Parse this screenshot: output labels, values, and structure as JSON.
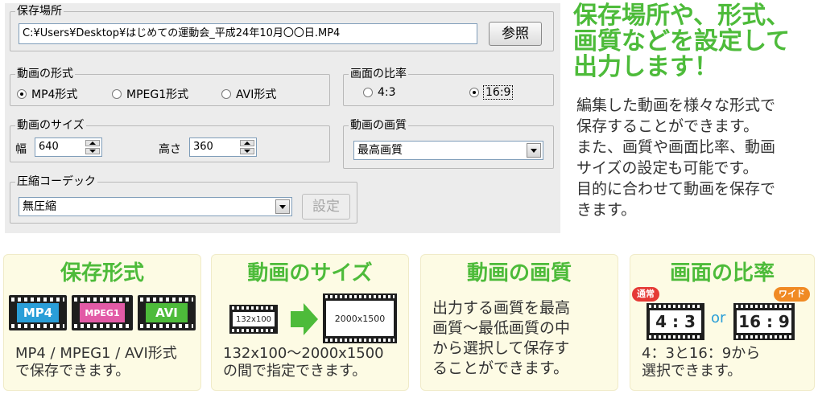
{
  "dialog": {
    "save_location": {
      "label": "保存場所",
      "path": "C:¥Users¥Desktop¥はじめての運動会_平成24年10月〇〇日.MP4",
      "browse_label": "参照"
    },
    "format": {
      "label": "動画の形式",
      "options": [
        "MP4形式",
        "MPEG1形式",
        "AVI形式"
      ],
      "selected": "MP4形式"
    },
    "aspect": {
      "label": "画面の比率",
      "options": [
        "4:3",
        "16:9"
      ],
      "selected": "16:9"
    },
    "size": {
      "label": "動画のサイズ",
      "width_label": "幅",
      "width_value": "640",
      "height_label": "高さ",
      "height_value": "360"
    },
    "quality": {
      "label": "動画の画質",
      "value": "最高画質"
    },
    "codec": {
      "label": "圧縮コーデック",
      "value": "無圧縮",
      "settings_label": "設定"
    }
  },
  "headline": {
    "lines": [
      "保存場所や、形式、",
      "画質などを設定して",
      "出力します！"
    ],
    "color": "#4dbb3a"
  },
  "description": {
    "lines": [
      "編集した動画を様々な形式で",
      "保存することができます。",
      "また、画質や画面比率、動画",
      "サイズの設定も可能です。",
      "目的に合わせて動画を保存で",
      "きます。"
    ]
  },
  "cards": {
    "format": {
      "title": "保存形式",
      "film_labels": [
        "MP4",
        "MPEG1",
        "AVI"
      ],
      "caption": [
        "MP4 / MPEG1 / AVI形式",
        "で保存できます。"
      ]
    },
    "size": {
      "title": "動画のサイズ",
      "small_label": "132x100",
      "large_label": "2000x1500",
      "caption": [
        "132x100〜2000x1500",
        "の間で指定できます。"
      ]
    },
    "quality": {
      "title": "動画の画質",
      "body": [
        "出力する画質を最高",
        "画質〜最低画質の中",
        "から選択して保存す",
        "ることができます。"
      ]
    },
    "ratio": {
      "title": "画面の比率",
      "normal_badge": "通常",
      "wide_badge": "ワイド",
      "ratio_43": "4 : 3",
      "ratio_169": "16 : 9",
      "or_text": "or",
      "caption": [
        "4：3と16：9から",
        "選択できます。"
      ]
    }
  },
  "colors": {
    "accent_green": "#4dbb3a",
    "card_bg": "#fdfbe4",
    "mp4_blue": "#2a9ed8",
    "mpeg1_pink": "#e25aa6",
    "avi_green": "#4dbb3a",
    "badge_red": "#e53935",
    "badge_orange": "#f08a24"
  }
}
